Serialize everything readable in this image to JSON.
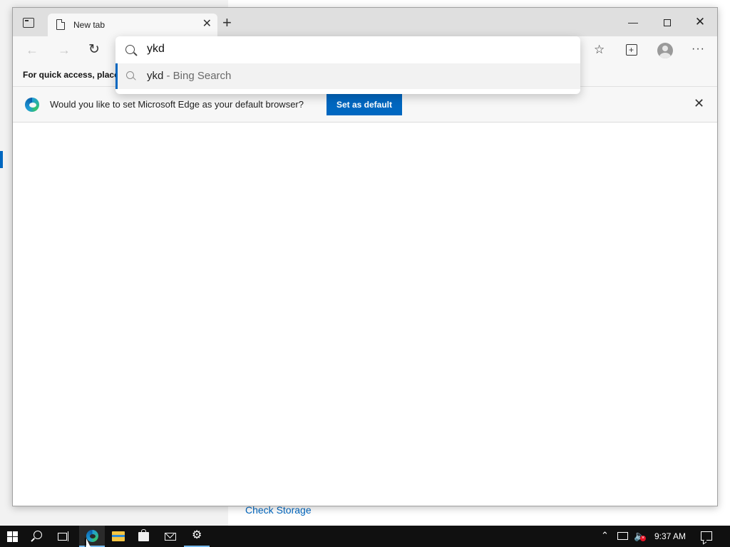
{
  "background_window": {
    "check_storage_link": "Check Storage"
  },
  "browser": {
    "tab": {
      "title": "New tab",
      "close_glyph": "✕"
    },
    "new_tab_glyph": "+",
    "window_controls": {
      "minimize_glyph": "—",
      "close_glyph": "✕"
    },
    "toolbar": {
      "back_glyph": "←",
      "forward_glyph": "→",
      "refresh_glyph": "↻",
      "favorites_glyph": "☆",
      "more_glyph": "···"
    },
    "favorites_bar": {
      "text": "For quick access, place y"
    },
    "omnibox": {
      "value": "ykd",
      "suggestion_query": "ykd",
      "suggestion_suffix": " - Bing Search"
    },
    "infobar": {
      "message": "Would you like to set Microsoft Edge as your default browser?",
      "button_label": "Set as default",
      "close_glyph": "✕"
    }
  },
  "taskbar": {
    "settings_glyph": "⚙",
    "tray_chevron": "⌃",
    "volume_glyph": "🔈",
    "volume_muted_glyph": "×",
    "time": "9:37 AM"
  },
  "colors": {
    "accent": "#0067c0",
    "taskbar": "#101010",
    "titlebar": "#dfdfdf"
  },
  "icons": [
    "tab-actions-icon",
    "page-icon",
    "search-icon",
    "refresh-icon",
    "favorites-icon",
    "collections-icon",
    "profile-avatar",
    "more-icon",
    "edge-logo-icon",
    "windows-start-icon",
    "task-view-icon",
    "file-explorer-icon",
    "store-icon",
    "mail-icon",
    "settings-icon",
    "network-icon",
    "volume-icon",
    "notifications-icon"
  ]
}
